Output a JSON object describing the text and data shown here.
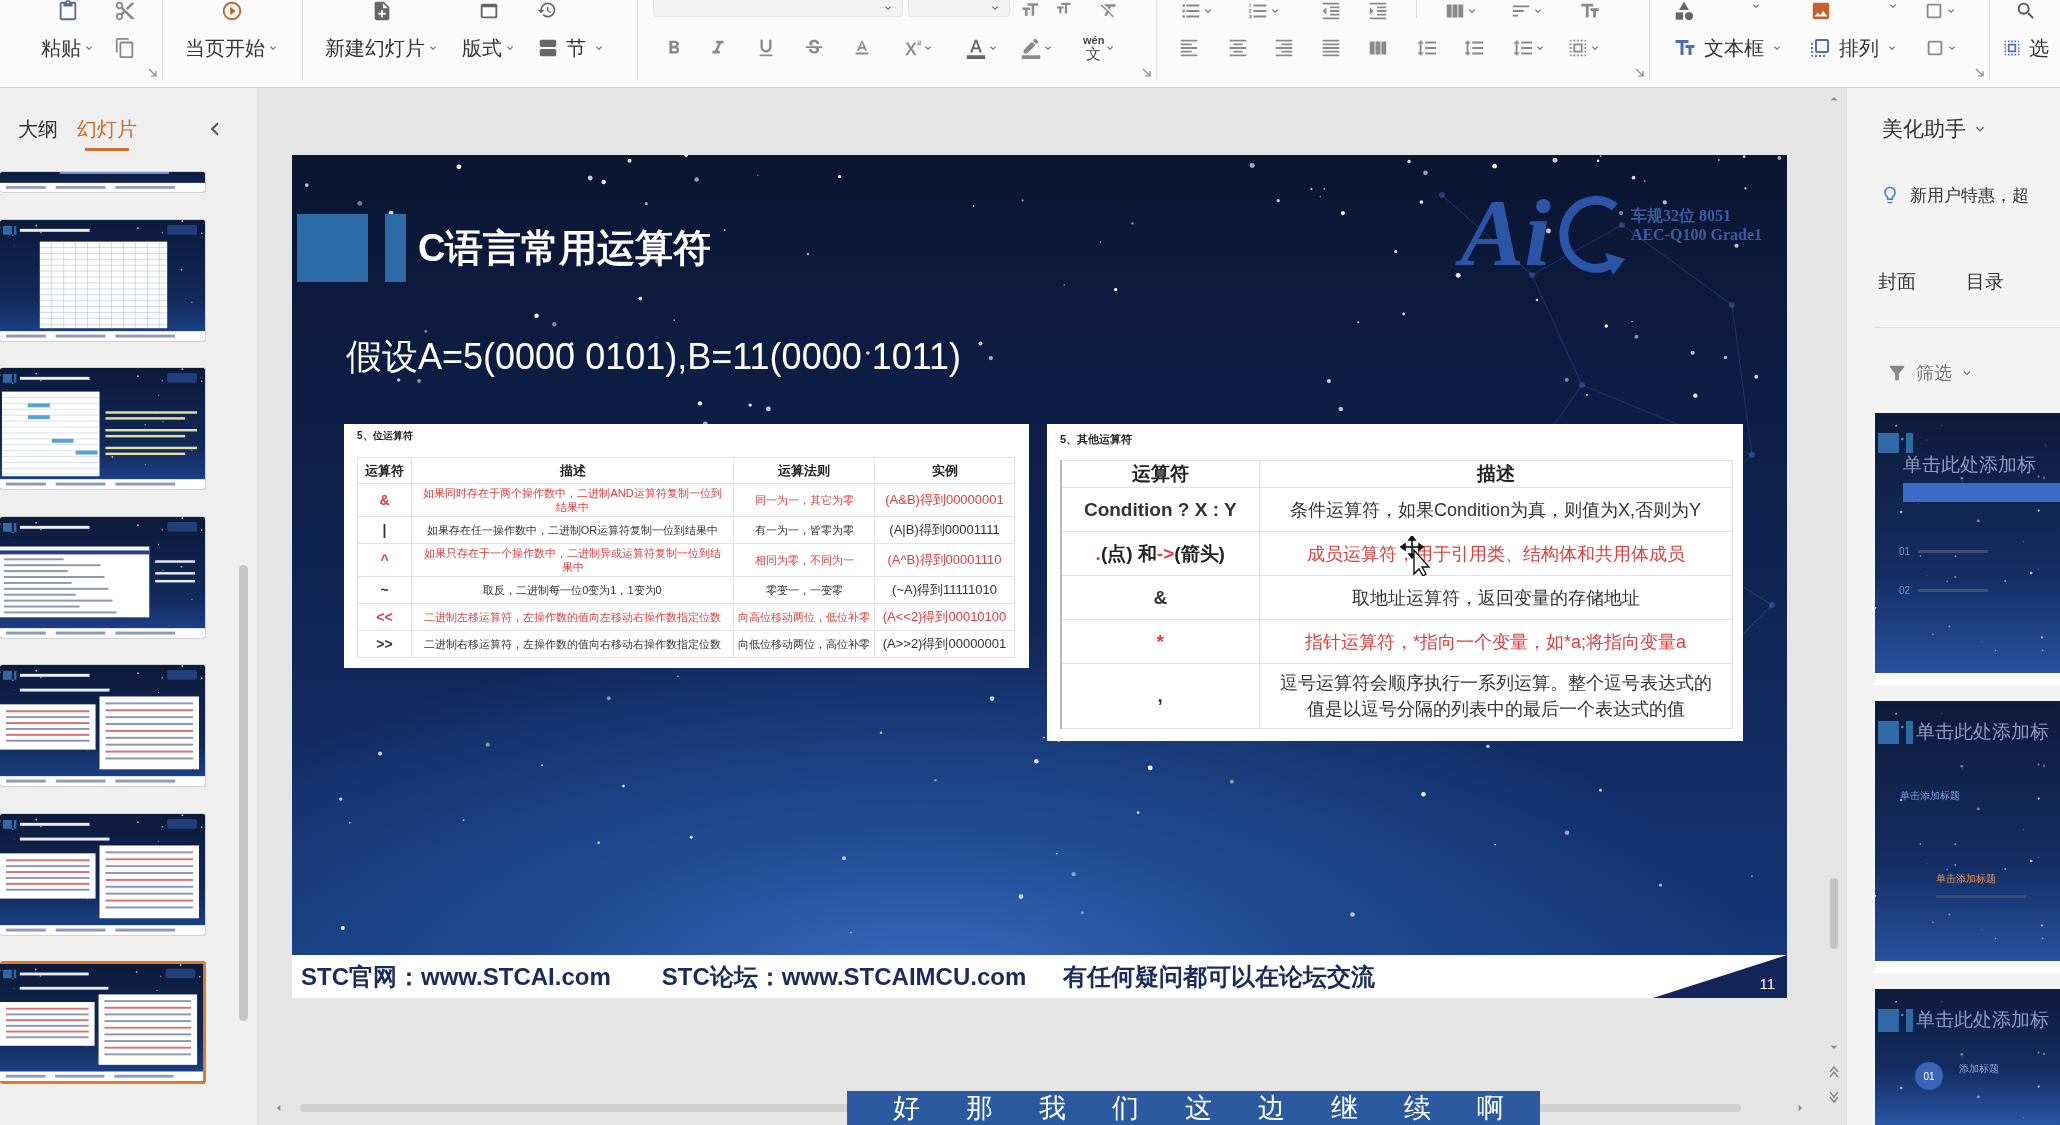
{
  "toolbar": {
    "paste": "粘贴",
    "start_from_current": "当页开始",
    "new_slide": "新建幻灯片",
    "layout": "版式",
    "section": "节",
    "phonetic_guide": {
      "ruby": "wén",
      "base": "文"
    },
    "text_box": "文本框",
    "arrange": "排列",
    "select": "选"
  },
  "slide_panel": {
    "tabs": [
      {
        "label": "大纲",
        "selected": false
      },
      {
        "label": "幻灯片",
        "selected": true
      }
    ],
    "thumbnails": [
      {
        "kind": "footer-only",
        "selected": false
      },
      {
        "kind": "wide-table",
        "selected": false
      },
      {
        "kind": "table-and-notes",
        "selected": false
      },
      {
        "kind": "listing",
        "selected": false
      },
      {
        "kind": "two-tables",
        "selected": false
      },
      {
        "kind": "two-tables",
        "selected": false
      },
      {
        "kind": "two-tables",
        "selected": true
      }
    ]
  },
  "slide": {
    "title": "C语言常用运算符",
    "logo": {
      "text": "Ai",
      "lines": [
        "车规32位 8051",
        "AEC-Q100 Grade1"
      ]
    },
    "assumption": "假设A=5(0000 0101),B=11(0000 1011)",
    "tables": [
      {
        "title": "5、位运算符",
        "columns": [
          "运算符",
          "描述",
          "运算法则",
          "实例"
        ],
        "rows": [
          {
            "highlighted": true,
            "cells": [
              "&",
              "如果同时存在于两个操作数中，二进制AND运算符复制一位到结果中",
              "同一为一，其它为零",
              "(A&B)得到00000001"
            ]
          },
          {
            "highlighted": false,
            "cells": [
              "|",
              "如果存在任一操作数中，二进制OR运算符复制一位到结果中",
              "有一为一，皆零为零",
              "(A|B)得到00001111"
            ]
          },
          {
            "highlighted": true,
            "cells": [
              "^",
              "如果只存在于一个操作数中，二进制异或运算符复制一位到结果中",
              "相同为零，不同为一",
              "(A^B)得到00001110"
            ]
          },
          {
            "highlighted": false,
            "cells": [
              "~",
              "取反，二进制每一位0变为1，1变为0",
              "零变一，一变零",
              "(~A)得到11111010"
            ]
          },
          {
            "highlighted": true,
            "cells": [
              "<<",
              "二进制左移运算符，左操作数的值向左移动右操作数指定位数",
              "向高位移动两位，低位补零",
              "(A<<2)得到00010100"
            ]
          },
          {
            "highlighted": false,
            "cells": [
              ">>",
              "二进制右移运算符，左操作数的值向右移动右操作数指定位数",
              "向低位移动两位，高位补零",
              "(A>>2)得到00000001"
            ]
          }
        ]
      },
      {
        "title": "5、其他运算符",
        "columns": [
          "运算符",
          "描述"
        ],
        "rows": [
          {
            "highlighted": false,
            "cells": [
              "Condition ? X : Y",
              "条件运算符，如果Condition为真，则值为X,否则为Y"
            ]
          },
          {
            "highlighted": true,
            "cells": [
              [
                {
                  "text": ".",
                  "highlighted": true
                },
                {
                  "text": "(点) 和",
                  "highlighted": false
                },
                {
                  "text": "->",
                  "highlighted": true
                },
                {
                  "text": "(箭头)",
                  "highlighted": false
                }
              ],
              "成员运算符，用于引用类、结构体和共用体成员"
            ]
          },
          {
            "highlighted": false,
            "cells": [
              "&",
              "取地址运算符，返回变量的存储地址"
            ]
          },
          {
            "highlighted": true,
            "cells": [
              "*",
              "指针运算符，*指向一个变量，如*a;将指向变量a"
            ]
          },
          {
            "highlighted": false,
            "cells": [
              ",",
              "逗号运算符会顺序执行一系列运算。整个逗号表达式的值是以逗号分隔的列表中的最后一个表达式的值"
            ]
          }
        ]
      }
    ],
    "footer": {
      "items": [
        "STC官网：www.STCAI.com",
        "STC论坛：www.STCAIMCU.com",
        "有任何疑问都可以在论坛交流"
      ],
      "page_number": "11"
    }
  },
  "beautify_panel": {
    "title": "美化助手",
    "promo": "新用户特惠，超",
    "tabs": [
      {
        "label": "封面",
        "selected": false
      },
      {
        "label": "目录",
        "selected": false
      }
    ],
    "filter": "筛选",
    "templates": [
      {
        "kind": "agenda",
        "title": "单击此处添加标",
        "labels": [
          "01",
          "02"
        ]
      },
      {
        "kind": "section",
        "title": "单击此处添加标",
        "labels": [
          "单击添加标题",
          "单击添加标题"
        ]
      },
      {
        "kind": "numbered",
        "title": "单击此处添加标",
        "labels": [
          "01",
          "添加标题"
        ]
      }
    ]
  },
  "subtitle": "好那我们这边继续啊"
}
